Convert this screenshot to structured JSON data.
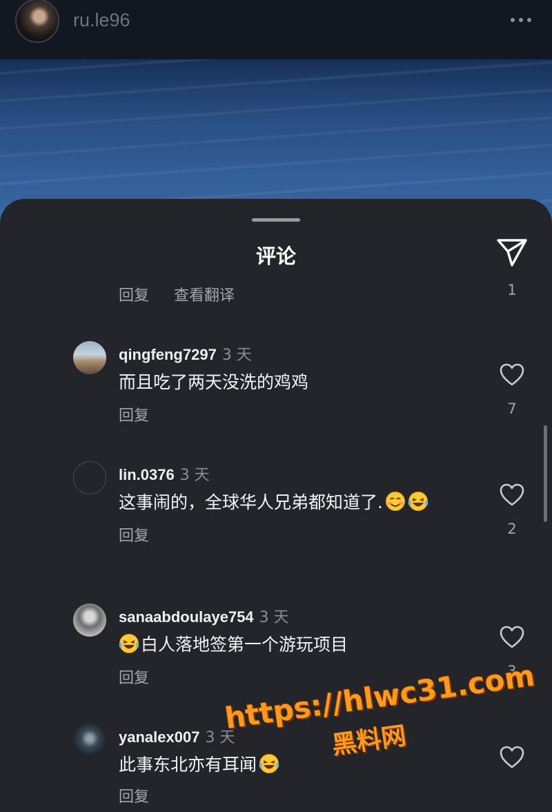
{
  "header": {
    "username": "ru.le96",
    "more_icon": "more-horizontal-icon"
  },
  "sheet": {
    "title": "评论",
    "send_icon": "send-icon"
  },
  "partial_comment": {
    "reply": "回复",
    "translate": "查看翻译",
    "likes": "1"
  },
  "comments": [
    {
      "username": "qingfeng7297",
      "time": "3 天",
      "text": "而且吃了两天没洗的鸡鸡",
      "reply": "回复",
      "likes": "7"
    },
    {
      "username": "lin.0376",
      "time": "3 天",
      "text": "这事闹的，全球华人兄弟都知道了.",
      "emoji": [
        "smiling-face-emoji",
        "laughing-tears-emoji"
      ],
      "reply": "回复",
      "likes": "2"
    },
    {
      "username": "sanaabdoulaye754",
      "time": "3 天",
      "emoji_prefix": "laughing-tears-emoji",
      "text": "白人落地签第一个游玩项目",
      "reply": "回复",
      "likes": "3"
    },
    {
      "username": "yanalex007",
      "time": "3 天",
      "text": "此事东北亦有耳闻",
      "emoji": [
        "laughing-tears-emoji"
      ],
      "reply": "回复"
    }
  ],
  "watermark": {
    "url": "https://hlwc31.com",
    "name": "黑料网"
  },
  "colors": {
    "sheet_bg": "#23252b",
    "watermark": "#ff9a1f"
  }
}
